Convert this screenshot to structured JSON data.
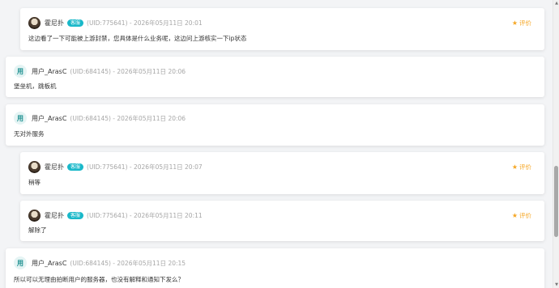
{
  "comments": [
    {
      "username": "霍尼扑",
      "badge": "客服",
      "meta": "(UID:775641) - 2026年05月11日 20:01",
      "content": "这边看了一下可能被上游封禁，您具体是什么业务呢，这边问上游核实一下ip状态",
      "rate_label": "评价"
    },
    {
      "avatar_text": "用",
      "username": "用户_ArasC",
      "meta": "(UID:684145) - 2026年05月11日 20:06",
      "content": "堡垒机，跳板机"
    },
    {
      "avatar_text": "用",
      "username": "用户_ArasC",
      "meta": "(UID:684145) - 2026年05月11日 20:06",
      "content": "无对外服务"
    },
    {
      "username": "霍尼扑",
      "badge": "客服",
      "meta": "(UID:775641) - 2026年05月11日 20:07",
      "content": "稍等",
      "rate_label": "评价"
    },
    {
      "username": "霍尼扑",
      "badge": "客服",
      "meta": "(UID:775641) - 2026年05月11日 20:11",
      "content": "解除了",
      "rate_label": "评价"
    },
    {
      "avatar_text": "用",
      "username": "用户_ArasC",
      "meta": "(UID:684145) - 2026年05月11日 20:15",
      "content": "所以可以无理由拍断用户的服务器，也没有解释和通知下发么？"
    }
  ],
  "colors": {
    "badge": "#19b8c9",
    "rate": "#f5a623",
    "user_avatar_bg": "#e5f4f4",
    "user_avatar_text": "#1c8f8f"
  },
  "icons": {
    "rate": "star-icon",
    "scroll_up": "chevron-up-icon",
    "scroll_down": "chevron-down-icon"
  }
}
